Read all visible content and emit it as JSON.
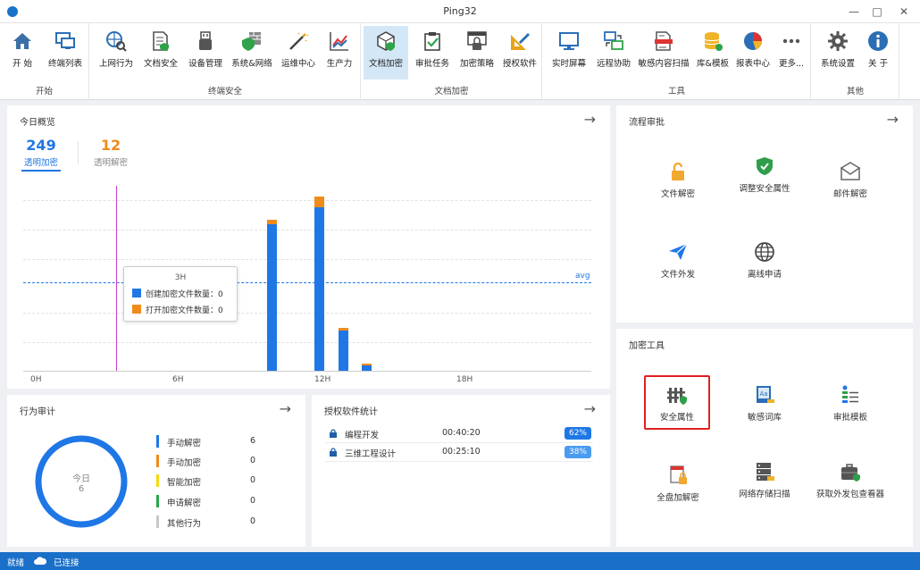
{
  "window": {
    "title": "Ping32"
  },
  "ribbon": {
    "groups": [
      {
        "label": "开始",
        "buttons": [
          "开 始",
          "终端列表"
        ]
      },
      {
        "label": "终端安全",
        "buttons": [
          "上网行为",
          "文档安全",
          "设备管理",
          "系统&网络",
          "运维中心",
          "生产力"
        ]
      },
      {
        "label": "文档加密",
        "buttons": [
          "文档加密",
          "审批任务",
          "加密策略",
          "授权软件"
        ]
      },
      {
        "label": "工具",
        "buttons": [
          "实时屏幕",
          "远程协助",
          "敏感内容扫描",
          "库&模板",
          "报表中心",
          "更多..."
        ]
      },
      {
        "label": "其他",
        "buttons": [
          "系统设置",
          "关 于"
        ]
      }
    ]
  },
  "overview": {
    "title": "今日概览",
    "stats": [
      {
        "value": "249",
        "label": "透明加密",
        "color": "#1f77e6"
      },
      {
        "value": "12",
        "label": "透明解密",
        "color": "#f08b1b"
      }
    ],
    "tooltip": {
      "title": "3H",
      "rows": [
        "创建加密文件数量：0",
        "打开加密文件数量：0"
      ]
    },
    "avg_label": "avg"
  },
  "chart_data": {
    "type": "bar",
    "stacked": true,
    "x_ticks": [
      "0H",
      "6H",
      "12H",
      "18H"
    ],
    "x": [
      10,
      12,
      13,
      14
    ],
    "series": [
      {
        "name": "创建加密文件数量",
        "color": "#1f77e6",
        "values": [
          166,
          186,
          46,
          6
        ]
      },
      {
        "name": "打开加密文件数量",
        "color": "#f08b1b",
        "values": [
          5,
          12,
          3,
          2
        ]
      }
    ],
    "avg_line": 100,
    "highlight_x": 3,
    "ylim": [
      0,
      210
    ],
    "grid": true
  },
  "audit": {
    "title": "行为审计",
    "donut": {
      "label": "今日",
      "value": "6"
    },
    "items": [
      {
        "name": "手动解密",
        "value": "6",
        "color": "#1f77e6"
      },
      {
        "name": "手动加密",
        "value": "0",
        "color": "#f08b1b"
      },
      {
        "name": "智能加密",
        "value": "0",
        "color": "#f5d90a"
      },
      {
        "name": "申请解密",
        "value": "0",
        "color": "#27a84a"
      },
      {
        "name": "其他行为",
        "value": "0",
        "color": "#c8c8c8"
      }
    ]
  },
  "software": {
    "title": "授权软件统计",
    "rows": [
      {
        "name": "编程开发",
        "time": "00:40:20",
        "pct": "62%",
        "color": "#1f77e6"
      },
      {
        "name": "三维工程设计",
        "time": "00:25:10",
        "pct": "38%",
        "color": "#4a9bf0"
      }
    ]
  },
  "approval": {
    "title": "流程审批",
    "tiles": [
      {
        "label": "文件解密",
        "icon": "unlock-icon"
      },
      {
        "label": "调整安全属性",
        "icon": "shield-check-icon"
      },
      {
        "label": "邮件解密",
        "icon": "mail-icon"
      },
      {
        "label": "文件外发",
        "icon": "send-icon"
      },
      {
        "label": "离线申请",
        "icon": "globe-icon"
      }
    ]
  },
  "tools": {
    "title": "加密工具",
    "tiles": [
      {
        "label": "安全属性",
        "icon": "security-attribute-icon"
      },
      {
        "label": "敏感词库",
        "icon": "sensitive-dictionary-icon"
      },
      {
        "label": "审批模板",
        "icon": "approval-template-icon"
      },
      {
        "label": "全盘加解密",
        "icon": "full-disk-encrypt-icon"
      },
      {
        "label": "网络存储扫描",
        "icon": "network-storage-icon"
      },
      {
        "label": "获取外发包查看器",
        "icon": "outbound-viewer-icon"
      }
    ]
  },
  "status": {
    "left": "就绪",
    "connection": "已连接"
  },
  "colors": {
    "accent": "#1f77e6",
    "orange": "#f08b1b",
    "status_bar": "#1a6fc9",
    "highlight": "#e02020"
  }
}
